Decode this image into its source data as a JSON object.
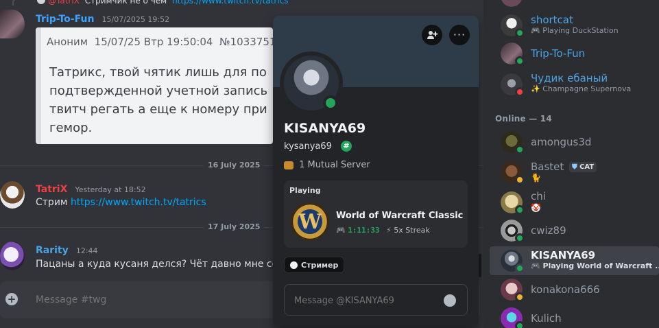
{
  "chat": {
    "reply_top": {
      "author": "@TatriX",
      "text": "Стримчик не о чем",
      "link": "https://www.twitch.tv/tatrics"
    },
    "messages": [
      {
        "author": "Trip-To-Fun",
        "author_color": "#3ba2ff",
        "timestamp": "15/07/2025 19:52",
        "embed": {
          "header": "Аноним  15/07/25 Втр 19:50:04  №1033751",
          "lines": [
            "Татрикс, твой чятик лишь для по",
            "подтвержденной учетной запись",
            "твитч регать а еще к номеру при",
            "гемор."
          ]
        }
      },
      {
        "author": "TatriX",
        "author_color": "#ed4245",
        "timestamp": "Yesterday at 18:52",
        "text": "Стрим",
        "link": "https://www.twitch.tv/tatrics"
      },
      {
        "author": "Rarity",
        "author_color": "#4aa3e6",
        "timestamp": "12:44",
        "text": "Пацаны а куда кусаня делся? Чёт давно мне сооб"
      }
    ],
    "dividers": [
      "16 July 2025",
      "17 July 2025"
    ],
    "input_placeholder": "Message #twg",
    "add_icon": "plus-circle-icon"
  },
  "profile": {
    "display_name": "KISANYA69",
    "username": "kysanya69",
    "badge_icon": "hashtag-badge-icon",
    "mutual": "1 Mutual Server",
    "activity": {
      "label": "Playing",
      "game": "World of Warcraft Classic",
      "elapsed": "1:11:33",
      "streak": "5x Streak"
    },
    "role": "Стример",
    "message_placeholder": "Message @KISANYA69",
    "colors": {
      "banner": "#2e3b48",
      "online": "#23a55a",
      "elapsed": "#23a55a"
    }
  },
  "members": {
    "top": [
      {
        "name": "shortcat",
        "name_color": "#4aa3e6",
        "activity": "Playing DuckStation",
        "activity_icon": "gamepad-icon"
      },
      {
        "name": "Trip-To-Fun",
        "name_color": "#4aa3e6",
        "activity": ""
      },
      {
        "name": "Чудик ебаный",
        "name_color": "#4aa3e6",
        "activity": "Champagne Supernova",
        "activity_icon": "sparkles-icon"
      }
    ],
    "section": "Online — 14",
    "online": [
      {
        "name": "amongus3d",
        "activity": ""
      },
      {
        "name": "Bastet",
        "tag": "CAT",
        "activity": "🐈"
      },
      {
        "name": "chi",
        "activity": "🤡"
      },
      {
        "name": "cwiz89",
        "activity": ""
      },
      {
        "name": "KISANYA69",
        "activity": "Playing World of Warcraft ...",
        "activity_icon": "gamepad-icon",
        "selected": true
      },
      {
        "name": "konakona666",
        "activity": ""
      },
      {
        "name": "Kulich",
        "activity": ""
      }
    ]
  }
}
